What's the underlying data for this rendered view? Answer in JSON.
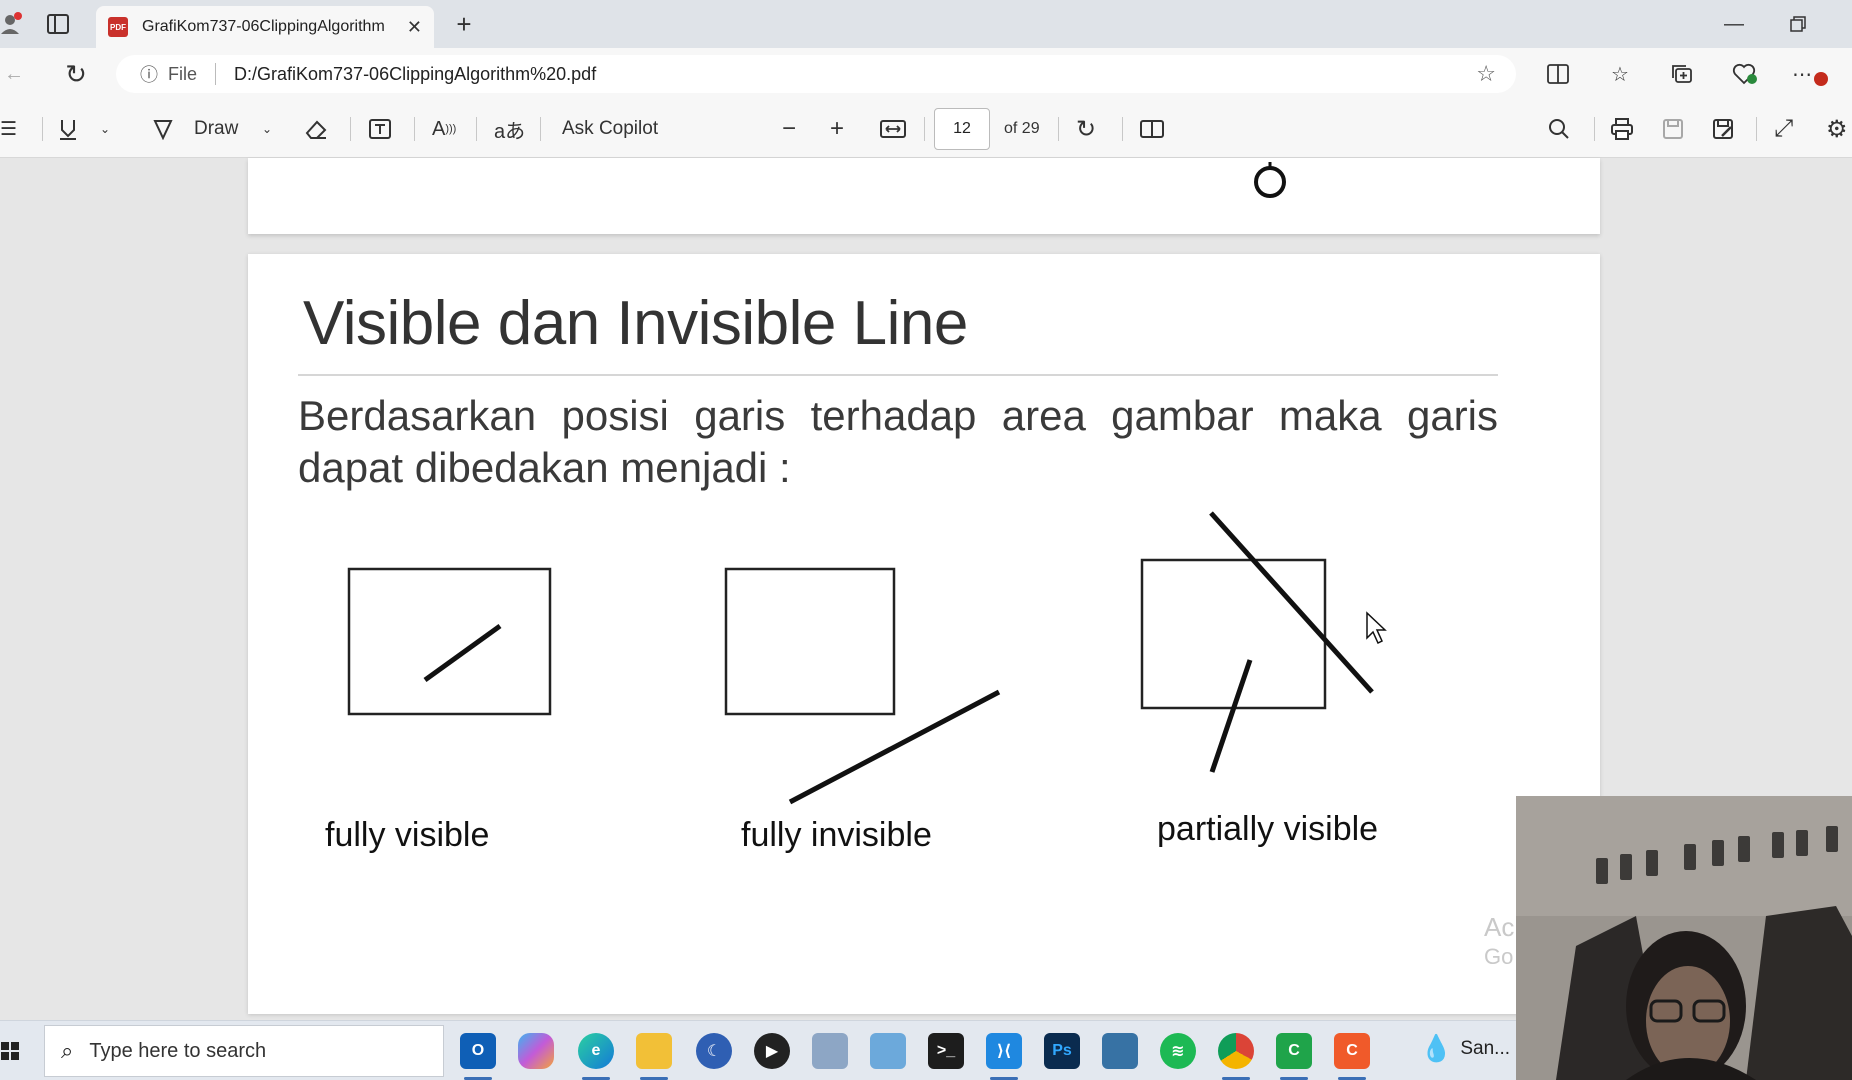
{
  "browser": {
    "tab_title": "GrafiKom737-06ClippingAlgorithm",
    "address_prefix": "File",
    "address_url": "D:/GrafiKom737-06ClippingAlgorithm%20.pdf"
  },
  "pdf_toolbar": {
    "draw_label": "Draw",
    "copilot_label": "Ask Copilot",
    "current_page": "12",
    "total_pages": "of 29"
  },
  "slide": {
    "title": "Visible dan Invisible Line",
    "body": "Berdasarkan posisi garis terhadap area gambar maka garis dapat dibedakan menjadi :",
    "captions": {
      "fully_visible": "fully visible",
      "fully_invisible": "fully invisible",
      "partially_visible": "partially visible"
    }
  },
  "watermark": {
    "line1": "Ac",
    "line2": "Go"
  },
  "taskbar": {
    "search_placeholder": "Type here to search",
    "weather_label": "San..."
  },
  "icons": {
    "tab_pdf": "pdf-icon",
    "photoshop": "Ps"
  }
}
